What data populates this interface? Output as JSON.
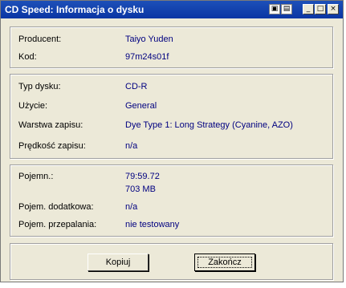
{
  "window": {
    "title": "CD Speed: Informacja o dysku",
    "controls": {
      "min": "_",
      "max": "□",
      "close": "×",
      "extra1": "▣",
      "extra2": "▤"
    }
  },
  "manufacturer": {
    "producer_label": "Producent:",
    "producer_value": "Taiyo Yuden",
    "code_label": "Kod:",
    "code_value": "97m24s01f"
  },
  "disc": {
    "type_label": "Typ dysku:",
    "type_value": "CD-R",
    "usage_label": "Użycie:",
    "usage_value": "General",
    "layer_label": "Warstwa zapisu:",
    "layer_value": "Dye Type 1: Long Strategy (Cyanine, AZO)",
    "speed_label": "Prędkość zapisu:",
    "speed_value": "n/a"
  },
  "capacity": {
    "capacity_label": "Pojemn.:",
    "capacity_time": "79:59.72",
    "capacity_size": "703 MB",
    "extra_label": "Pojem. dodatkowa:",
    "extra_value": "n/a",
    "overburn_label": "Pojem. przepalania:",
    "overburn_value": "nie testowany"
  },
  "buttons": {
    "copy": "Kopiuj",
    "finish": "Zakończ"
  }
}
